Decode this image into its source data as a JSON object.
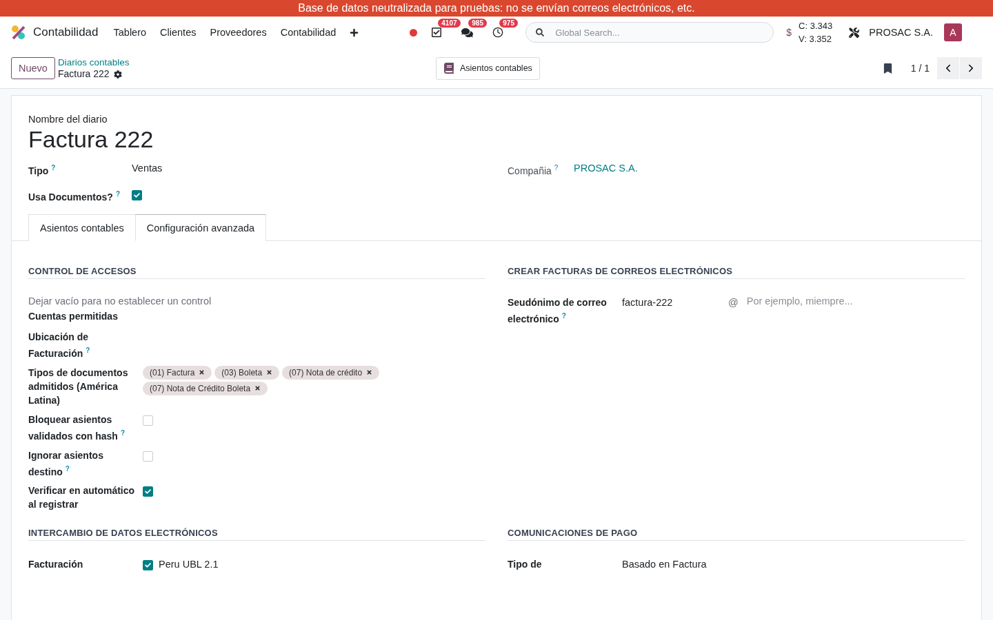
{
  "banner": "Base de datos neutralizada para pruebas: no se envían correos electrónicos, etc.",
  "navbar": {
    "app": "Contabilidad",
    "menus": [
      "Tablero",
      "Clientes",
      "Proveedores",
      "Contabilidad"
    ],
    "indicators": [
      {
        "kind": "activities",
        "count": "4107"
      },
      {
        "kind": "messages",
        "count": "985"
      },
      {
        "kind": "clock",
        "count": "975"
      }
    ],
    "search": {
      "placeholder": "Global Search..."
    },
    "currency": "$",
    "rates": [
      "C: 3.343",
      "V: 3.352"
    ],
    "company": "PROSAC S.A.",
    "avatar": "A"
  },
  "control_panel": {
    "new_button": "Nuevo",
    "breadcrumb": "Diarios contables",
    "record": "Factura 222",
    "smart_button": "Asientos contables",
    "pager": "1 / 1"
  },
  "form": {
    "title_label": "Nombre del diario",
    "title": "Factura 222",
    "header_fields": [
      {
        "label": "Tipo",
        "help": "?",
        "value": "Ventas",
        "kind": "text"
      },
      {
        "label": "Compañia",
        "help": "?",
        "value": "PROSAC S.A.",
        "kind": "link"
      },
      {
        "label": "Usa Documentos?",
        "help": "?",
        "kind": "checkbox",
        "checked": true
      }
    ],
    "tabs": [
      {
        "label": "Asientos contables",
        "selected": false
      },
      {
        "label": "Configuración avanzada",
        "selected": true
      }
    ],
    "sections": [
      {
        "title": "CONTROL DE ACCESOS",
        "fields": [
          {
            "kind": "note",
            "label": "Dejar vacío para no establecer un control"
          },
          {
            "kind": "label",
            "label": "Cuentas permitidas"
          },
          {
            "kind": "label",
            "label": "Ubicación de Facturación",
            "help": "?"
          },
          {
            "kind": "tags",
            "label": "Tipos de documentos admitidos (América Latina)",
            "tags": [
              "(01) Factura",
              "(03) Boleta",
              "(07) Nota de crédito",
              "(07) Nota de Crédito Boleta"
            ]
          },
          {
            "kind": "checkbox",
            "label": "Bloquear asientos validados con hash",
            "help": "?",
            "checked": false
          },
          {
            "kind": "checkbox",
            "label": "Ignorar asientos destino",
            "help": "?",
            "checked": false
          },
          {
            "kind": "checkbox",
            "label": "Verificar en automático al registrar",
            "checked": true
          }
        ]
      },
      {
        "title": "CREAR FACTURAS DE CORREOS ELECTRÓNICOS",
        "fields": [
          {
            "kind": "alias",
            "label": "Seudónimo de correo electrónico",
            "help": "?",
            "value": "factura-222",
            "at": "@",
            "placeholder": "Por ejemplo, miempre..."
          }
        ]
      },
      {
        "title": "INTERCAMBIO DE DATOS ELECTRÓNICOS",
        "fields": [
          {
            "kind": "checklabel",
            "label": "Facturación",
            "checked": true,
            "value": "Peru UBL 2.1"
          }
        ]
      },
      {
        "title": "COMUNICACIONES DE PAGO",
        "fields": [
          {
            "kind": "text",
            "label": "Tipo de",
            "value": "Basado en Factura"
          }
        ]
      }
    ]
  }
}
